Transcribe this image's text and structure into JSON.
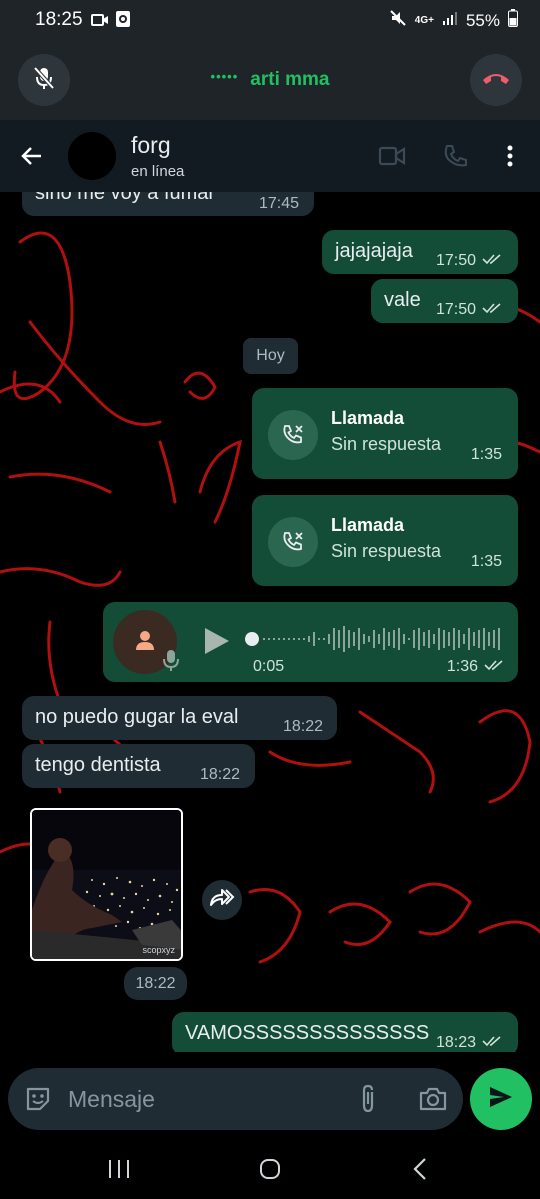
{
  "status_bar": {
    "time": "18:25",
    "network": "4G+",
    "battery": "55%"
  },
  "call_bar": {
    "caller": "arti mma",
    "dots": "•••••"
  },
  "header": {
    "contact_name": "forg",
    "contact_status": "en línea"
  },
  "messages": {
    "m0": {
      "text": "sino me voy a fumar",
      "time": "17:45"
    },
    "m1": {
      "text": "jajajajaja",
      "time": "17:50"
    },
    "m2": {
      "text": "vale",
      "time": "17:50"
    },
    "day": "Hoy",
    "call1": {
      "title": "Llamada",
      "subtitle": "Sin respuesta",
      "time": "1:35"
    },
    "call2": {
      "title": "Llamada",
      "subtitle": "Sin respuesta",
      "time": "1:35"
    },
    "voice": {
      "duration": "0:05",
      "time": "1:36",
      "progress": 0.0
    },
    "m3": {
      "text": "no puedo gugar la eval",
      "time": "18:22"
    },
    "m4": {
      "text": "tengo dentista",
      "time": "18:22"
    },
    "image": {
      "watermark": "scopxyz",
      "time": "18:22"
    },
    "m5": {
      "text": "VAMOSSSSSSSSSSSSSS",
      "time": "18:23"
    }
  },
  "input": {
    "placeholder": "Mensaje"
  },
  "colors": {
    "accent": "#21c063",
    "outgoing_bubble": "#134d37",
    "incoming_bubble": "#1f2c33",
    "scribble": "#b01010",
    "hangup": "#f15c6d"
  },
  "icons": [
    "mic-off-icon",
    "hangup-icon",
    "back-icon",
    "video-call-icon",
    "voice-call-icon",
    "menu-icon",
    "missed-call-icon",
    "play-icon",
    "person-icon",
    "mic-icon",
    "forward-icon",
    "sticker-icon",
    "attach-icon",
    "camera-icon",
    "send-icon",
    "recents-icon",
    "home-icon",
    "nav-back-icon"
  ]
}
